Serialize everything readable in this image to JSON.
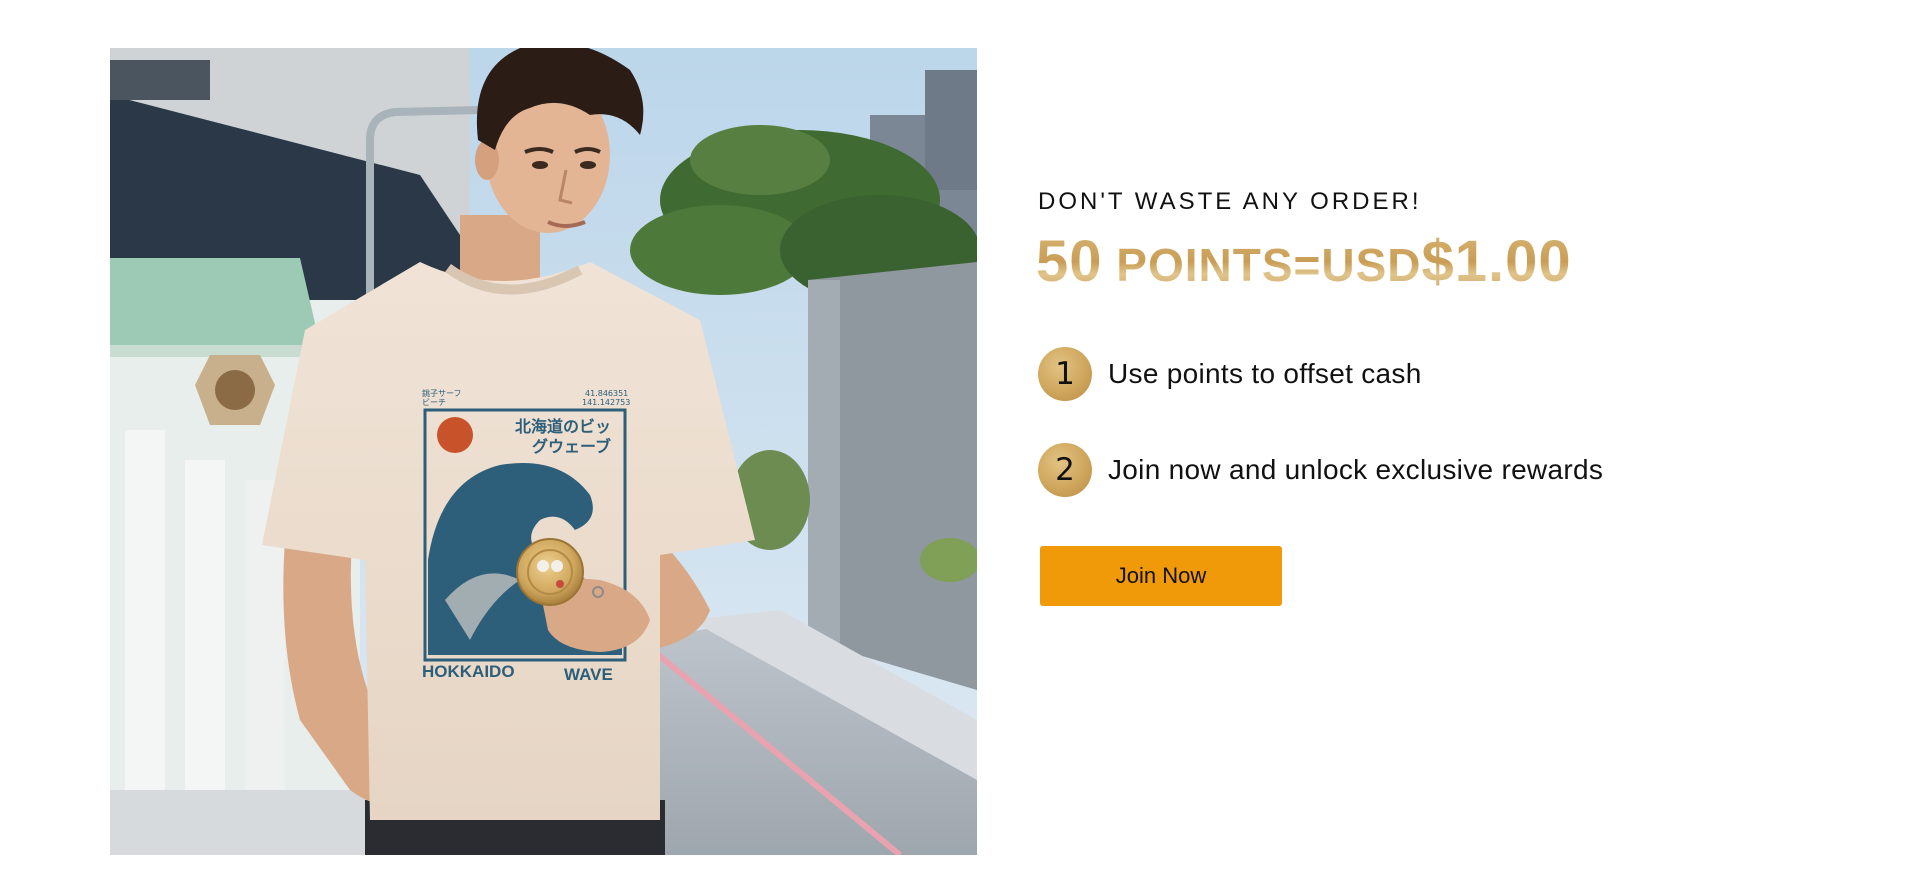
{
  "hero": {
    "shirt_print": {
      "vertical_title": "北海道のビッグウェーブ",
      "title_line1": "北海道のビッ",
      "title_line2": "グウェーブ",
      "small_text_left_1": "銚子サーフ",
      "small_text_left_2": "ビーチ",
      "coordinates_1": "41.846351",
      "coordinates_2": "141.142753",
      "left_word": "HOKKAIDO",
      "right_word": "WAVE"
    }
  },
  "promo": {
    "eyebrow": "DON'T WASTE ANY ORDER!",
    "headline": {
      "part1": "50",
      "part2": " POINTS=USD",
      "part3": "$1.00"
    },
    "steps": [
      {
        "number": "1",
        "text": "Use points to offset cash"
      },
      {
        "number": "2",
        "text": "Join now and unlock exclusive rewards"
      }
    ],
    "cta_label": "Join Now"
  },
  "colors": {
    "gold": "#cfa65d",
    "button": "#f09a09",
    "text": "#111111"
  }
}
